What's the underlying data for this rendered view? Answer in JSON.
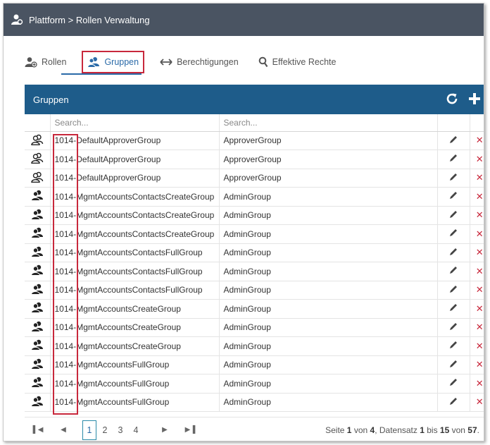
{
  "header": {
    "title": "Plattform > Rollen Verwaltung",
    "logo_icon": "user-group-icon"
  },
  "tabs": [
    {
      "label": "Rollen",
      "icon": "role-add-icon"
    },
    {
      "label": "Gruppen",
      "icon": "group-icon",
      "active": true
    },
    {
      "label": "Berechtigungen",
      "icon": "arrows-horizontal-icon"
    },
    {
      "label": "Effektive Rechte",
      "icon": "search-icon"
    }
  ],
  "panel": {
    "title": "Gruppen",
    "search_placeholder_1": "Search...",
    "search_placeholder_2": "Search..."
  },
  "rows": [
    {
      "icon": "outline-group-icon",
      "id": "1014-",
      "name": "DefaultApproverGroup",
      "type": "ApproverGroup"
    },
    {
      "icon": "outline-group-icon",
      "id": "1014-",
      "name": "DefaultApproverGroup",
      "type": "ApproverGroup"
    },
    {
      "icon": "outline-group-icon",
      "id": "1014-",
      "name": "DefaultApproverGroup",
      "type": "ApproverGroup"
    },
    {
      "icon": "solid-group-icon",
      "id": "1014-",
      "name": "MgmtAccountsContactsCreateGroup",
      "type": "AdminGroup"
    },
    {
      "icon": "solid-group-icon",
      "id": "1014-",
      "name": "MgmtAccountsContactsCreateGroup",
      "type": "AdminGroup"
    },
    {
      "icon": "solid-group-icon",
      "id": "1014-",
      "name": "MgmtAccountsContactsCreateGroup",
      "type": "AdminGroup"
    },
    {
      "icon": "solid-group-icon",
      "id": "1014-",
      "name": "MgmtAccountsContactsFullGroup",
      "type": "AdminGroup"
    },
    {
      "icon": "solid-group-icon",
      "id": "1014-",
      "name": "MgmtAccountsContactsFullGroup",
      "type": "AdminGroup"
    },
    {
      "icon": "solid-group-icon",
      "id": "1014-",
      "name": "MgmtAccountsContactsFullGroup",
      "type": "AdminGroup"
    },
    {
      "icon": "solid-group-icon",
      "id": "1014-",
      "name": "MgmtAccountsCreateGroup",
      "type": "AdminGroup"
    },
    {
      "icon": "solid-group-icon",
      "id": "1014-",
      "name": "MgmtAccountsCreateGroup",
      "type": "AdminGroup"
    },
    {
      "icon": "solid-group-icon",
      "id": "1014-",
      "name": "MgmtAccountsCreateGroup",
      "type": "AdminGroup"
    },
    {
      "icon": "solid-group-icon",
      "id": "1014-",
      "name": "MgmtAccountsFullGroup",
      "type": "AdminGroup"
    },
    {
      "icon": "solid-group-icon",
      "id": "1014-",
      "name": "MgmtAccountsFullGroup",
      "type": "AdminGroup"
    },
    {
      "icon": "solid-group-icon",
      "id": "1014-",
      "name": "MgmtAccountsFullGroup",
      "type": "AdminGroup"
    }
  ],
  "pager": {
    "pages": [
      "1",
      "2",
      "3",
      "4"
    ],
    "current": "1",
    "info_prefix": "Seite ",
    "page": "1",
    "info_of": " von ",
    "page_total": "4",
    "info_mid": ", Datensatz ",
    "rec_from": "1",
    "info_to": " bis ",
    "rec_to": "15",
    "info_of2": " von ",
    "rec_total": "57",
    "info_end": "."
  },
  "colors": {
    "topbar": "#4a5462",
    "panel_header": "#1e5c8a",
    "accent": "#2a6aa8",
    "highlight": "#c8283c",
    "delete": "#c8283c"
  }
}
